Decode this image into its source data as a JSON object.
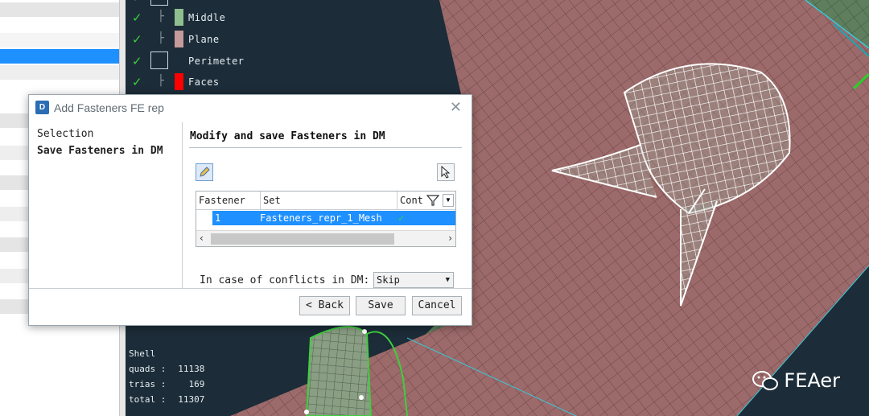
{
  "colors": {
    "middle_swatch": "#8fbf8f",
    "plane_swatch": "#c49a9a",
    "faces_swatch": "#ff0000",
    "selection_highlight": "#1e90ff",
    "check_green": "#3ecf3e"
  },
  "tree": {
    "items": [
      {
        "label": "Middle",
        "checked": true,
        "icon": "swatch"
      },
      {
        "label": "Plane",
        "checked": true,
        "icon": "swatch"
      },
      {
        "label": "Perimeter",
        "checked": true,
        "icon": "box"
      },
      {
        "label": "Faces",
        "checked": true,
        "icon": "swatch"
      }
    ]
  },
  "stats": {
    "title": "Shell",
    "quads_label": "quads :",
    "quads_value": "11138",
    "trias_label": "trias :",
    "trias_value": "169",
    "total_label": "total :",
    "total_value": "11307"
  },
  "watermark": {
    "text": "FEAer",
    "icon": "wechat-icon"
  },
  "dialog": {
    "title": "Add Fasteners FE rep",
    "nav": [
      "Selection",
      "Save Fasteners in DM"
    ],
    "content_title": "Modify and save Fasteners in DM",
    "grid": {
      "columns": [
        "Fastener",
        "Set",
        "Cont"
      ],
      "rows": [
        {
          "fastener": "1",
          "set": "Fasteners_repr_1_Mesh",
          "cont": "✓"
        }
      ]
    },
    "conflicts_label": "In case of conflicts in DM:",
    "conflicts_value": "Skip",
    "buttons": {
      "back": "< Back",
      "save": "Save",
      "cancel": "Cancel"
    }
  }
}
